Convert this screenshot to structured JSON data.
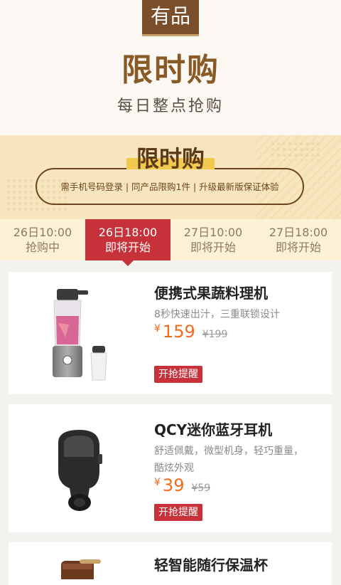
{
  "header": {
    "badge": "有品",
    "title": "限时购",
    "subtitle": "每日整点抢购"
  },
  "banner": {
    "title": "限时购",
    "rules": "需手机号码登录 | 同产品限购1件 | 升级最新版保证体验"
  },
  "tabs": [
    {
      "time": "26日10:00",
      "status": "抢购中"
    },
    {
      "time": "26日18:00",
      "status": "即将开始"
    },
    {
      "time": "27日10:00",
      "status": "即将开始"
    },
    {
      "time": "27日18:00",
      "status": "即将开始"
    }
  ],
  "products": [
    {
      "name": "便携式果蔬料理机",
      "desc": "8秒快速出汁，三重联锁设计",
      "currency": "¥",
      "price": "159",
      "old_price": "¥199",
      "action": "开抢提醒",
      "icon": "blender-icon"
    },
    {
      "name": "QCY迷你蓝牙耳机",
      "desc": "舒适佩戴，微型机身，轻巧重量，酷炫外观",
      "currency": "¥",
      "price": "39",
      "old_price": "¥59",
      "action": "开抢提醒",
      "icon": "earbud-icon"
    },
    {
      "name": "轻智能随行保温杯",
      "icon": "thermos-icon"
    }
  ],
  "colors": {
    "accent": "#c7323a",
    "brand_brown": "#7a4e2a",
    "price": "#ef6b1c"
  }
}
